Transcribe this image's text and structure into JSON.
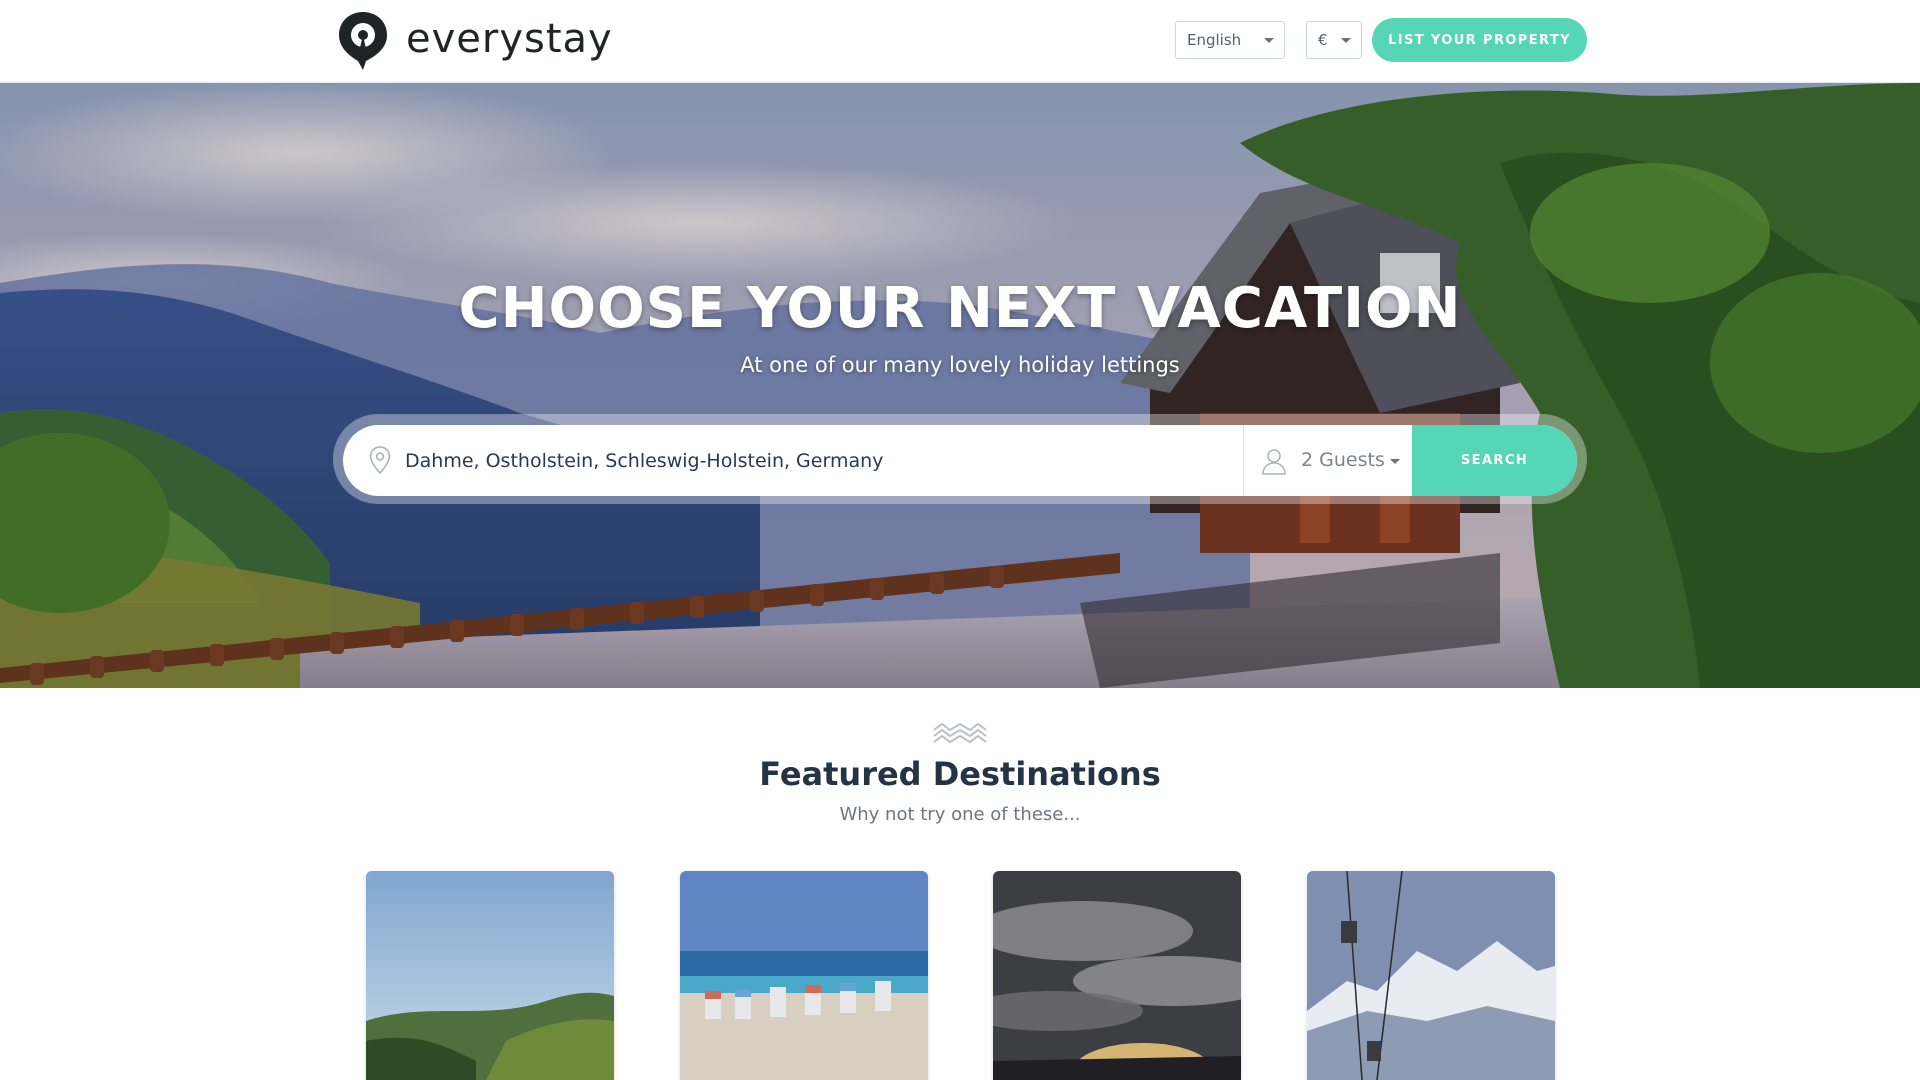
{
  "brand": {
    "name": "everystay",
    "accent_color": "#54d6b7"
  },
  "header": {
    "language": {
      "selected": "English"
    },
    "currency": {
      "selected": "€"
    },
    "list_property_label": "LIST YOUR PROPERTY"
  },
  "hero": {
    "title": "CHOOSE YOUR NEXT VACATION",
    "subtitle": "At one of our many lovely holiday lettings",
    "search": {
      "location_value": "Dahme, Ostholstein, Schleswig-Holstein, Germany",
      "location_icon": "map-pin-icon",
      "guests_value": "2 Guests",
      "guests_icon": "user-icon",
      "search_label": "SEARCH"
    }
  },
  "featured": {
    "icon": "waves-icon",
    "title": "Featured Destinations",
    "subtitle": "Why not try one of these..."
  }
}
